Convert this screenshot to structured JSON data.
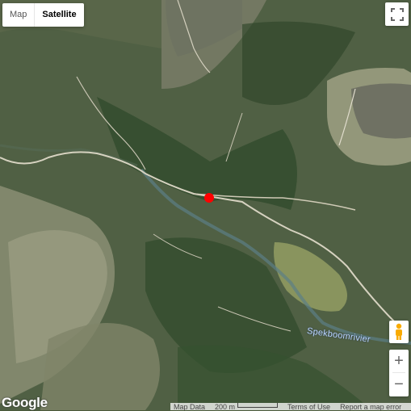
{
  "map_type": {
    "map_label": "Map",
    "satellite_label": "Satellite",
    "selected": "Satellite"
  },
  "labels": {
    "river": "Spekboomrivier"
  },
  "branding": {
    "logo": "Google"
  },
  "attribution": {
    "map_data": "Map Data",
    "scale": "200 m",
    "terms": "Terms of Use",
    "report": "Report a map error"
  },
  "controls": {
    "zoom_in": "+",
    "zoom_out": "−",
    "fullscreen_icon": "fullscreen-icon",
    "pegman_icon": "pegman-icon"
  },
  "marker": {
    "color": "#ff0000"
  },
  "colors": {
    "terrain_dark": "#2f4a2a",
    "terrain_light": "#8c9474",
    "road": "#d8d4c4",
    "water": "#5a7f88"
  }
}
